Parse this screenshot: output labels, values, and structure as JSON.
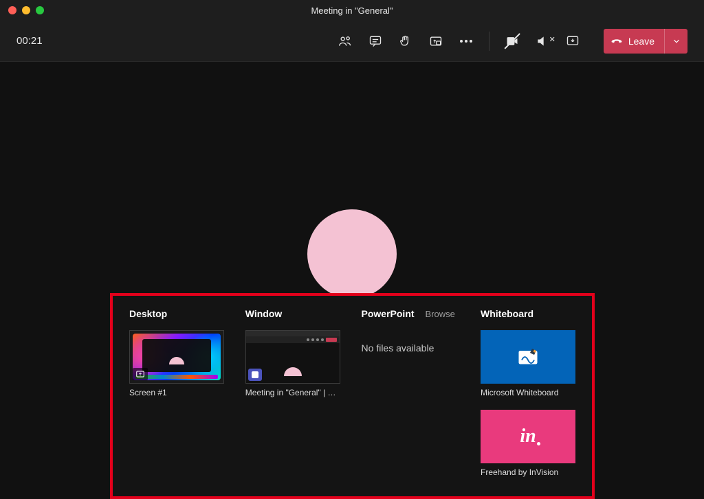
{
  "window": {
    "title": "Meeting in \"General\""
  },
  "toolbar": {
    "timer": "00:21",
    "leave_label": "Leave"
  },
  "share": {
    "desktop": {
      "title": "Desktop",
      "items": [
        {
          "label": "Screen #1"
        }
      ]
    },
    "window": {
      "title": "Window",
      "items": [
        {
          "label": "Meeting in \"General\" | M…"
        }
      ]
    },
    "powerpoint": {
      "title": "PowerPoint",
      "browse_label": "Browse",
      "empty_label": "No files available"
    },
    "whiteboard": {
      "title": "Whiteboard",
      "items": [
        {
          "label": "Microsoft Whiteboard"
        },
        {
          "label": "Freehand by InVision"
        }
      ]
    }
  },
  "colors": {
    "accent_leave": "#c73a52",
    "highlight_border": "#e3001b",
    "avatar": "#f4c2d3",
    "ms_whiteboard": "#0364b8",
    "invision": "#e93a7d"
  }
}
